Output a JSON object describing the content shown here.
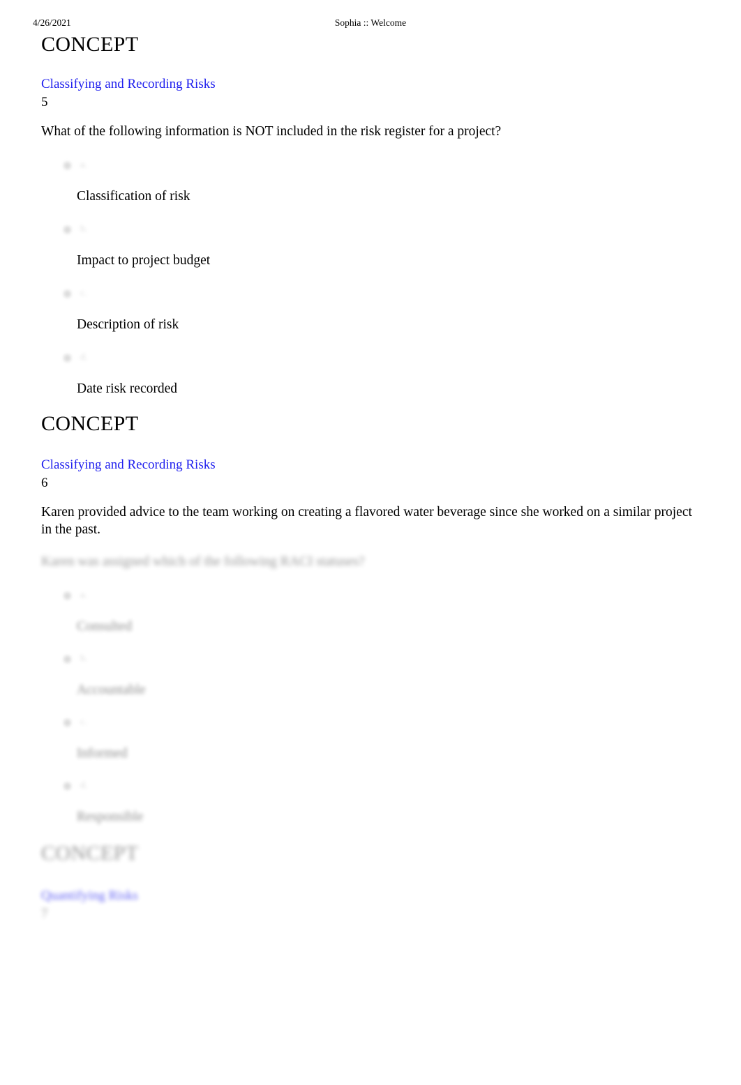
{
  "header": {
    "date": "4/26/2021",
    "title": "Sophia :: Welcome"
  },
  "sections": [
    {
      "heading": "CONCEPT",
      "concept_link": "Classifying and Recording Risks",
      "number": "5",
      "question": "What of the following information is NOT included in the risk register for a project?",
      "options": [
        {
          "letter": "a.",
          "label": "Classification of risk"
        },
        {
          "letter": "b.",
          "label": "Impact to project budget"
        },
        {
          "letter": "c.",
          "label": "Description of risk"
        },
        {
          "letter": "d.",
          "label": "Date risk recorded"
        }
      ]
    },
    {
      "heading": "CONCEPT",
      "concept_link": "Classifying and Recording Risks",
      "number": "6",
      "question": "Karen provided advice to the team working on creating a flavored water beverage since she worked on a similar project in the past.",
      "question_followup": "Karen was assigned which of the following RACI statuses?",
      "options": [
        {
          "letter": "a.",
          "label": "Consulted"
        },
        {
          "letter": "b.",
          "label": "Accountable"
        },
        {
          "letter": "c.",
          "label": "Informed"
        },
        {
          "letter": "d.",
          "label": "Responsible"
        }
      ]
    },
    {
      "heading": "CONCEPT",
      "concept_link": "Quantifying Risks",
      "number": "7"
    }
  ],
  "colors": {
    "link": "#2020ee",
    "text": "#000000",
    "page_background": "#ffffff"
  }
}
